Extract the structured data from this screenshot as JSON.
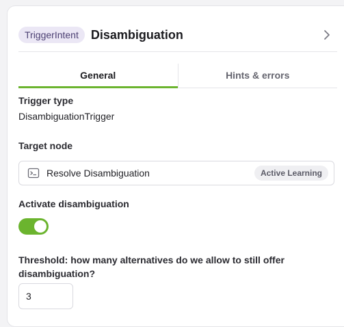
{
  "header": {
    "badge": "TriggerIntent",
    "title": "Disambiguation",
    "chevron_icon": "chevron-right-icon"
  },
  "tabs": [
    {
      "label": "General",
      "active": true
    },
    {
      "label": "Hints & errors",
      "active": false
    }
  ],
  "trigger_type": {
    "label": "Trigger type",
    "value": "DisambiguationTrigger"
  },
  "target_node": {
    "label": "Target node",
    "icon": "terminal-icon",
    "name": "Resolve Disambiguation",
    "tag": "Active Learning"
  },
  "activate_disambiguation": {
    "label": "Activate disambiguation",
    "enabled": true
  },
  "threshold": {
    "label": "Threshold: how many alternatives do we allow to still offer disambiguation?",
    "value": "3"
  },
  "colors": {
    "accent": "#6bb42e",
    "badge_bg": "#ebe7f5",
    "tag_bg": "#efeff2"
  }
}
